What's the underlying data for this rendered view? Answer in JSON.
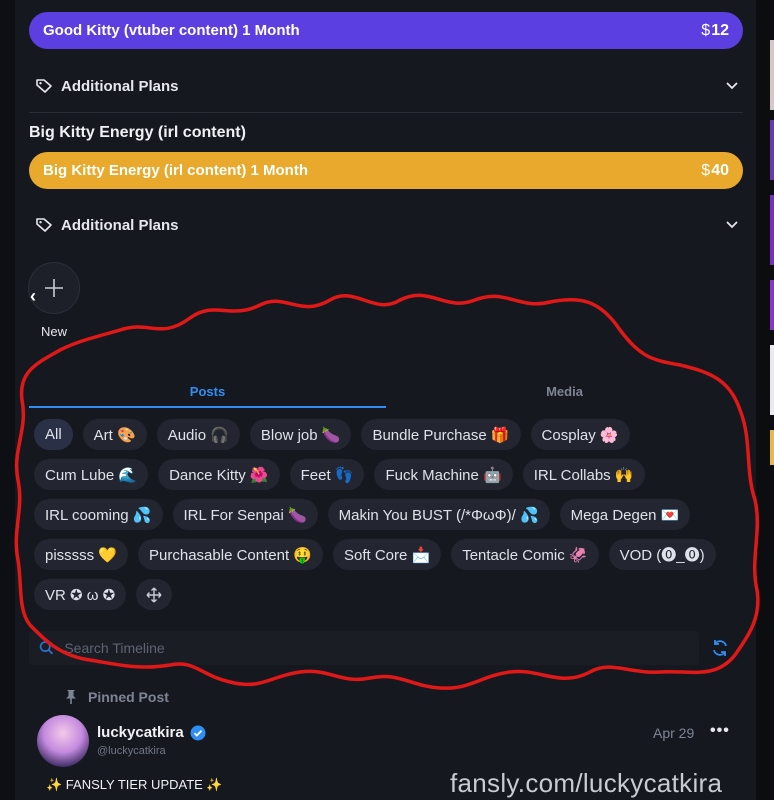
{
  "plans": [
    {
      "title": "Big Kitty Energy (irl content)",
      "button_label": "Good Kitty (vtuber content) 1 Month",
      "currency": "$",
      "price": "12",
      "color": "#5b3fe0"
    },
    {
      "button_label": "Big Kitty Energy (irl content) 1 Month",
      "currency": "$",
      "price": "40",
      "color": "#e8a92c"
    }
  ],
  "additional_plans_label": "Additional Plans",
  "section_title": "Big Kitty Energy (irl content)",
  "story": {
    "new_label": "New"
  },
  "tabs": [
    {
      "label": "Posts",
      "active": true
    },
    {
      "label": "Media",
      "active": false
    }
  ],
  "chips": [
    "All",
    "Art 🎨",
    "Audio 🎧",
    "Blow job 🍆",
    "Bundle Purchase 🎁",
    "Cosplay 🌸",
    "Cum Lube 🌊",
    "Dance Kitty 🌺",
    "Feet 👣",
    "Fuck Machine 🤖",
    "IRL Collabs 🙌",
    "IRL cooming 💦",
    "IRL For Senpai 🍆",
    "Makin You BUST (/*ΦωΦ)/ 💦",
    "Mega Degen 💌",
    "pisssss 💛",
    "Purchasable Content 🤑",
    "Soft Core 📩",
    "Tentacle Comic 🦑",
    "VOD (⓿_⓿)",
    "VR ✪ ω ✪"
  ],
  "search": {
    "placeholder": "Search Timeline"
  },
  "pinned_label": "Pinned Post",
  "post": {
    "username": "luckycatkira",
    "handle": "@luckycatkira",
    "date": "Apr 29",
    "text": "✨ FANSLY TIER UPDATE ✨"
  },
  "watermark": "fansly.com/luckycatkira",
  "colors": {
    "accent": "#2f8ef4",
    "background": "#16181f",
    "chip": "#232631"
  }
}
